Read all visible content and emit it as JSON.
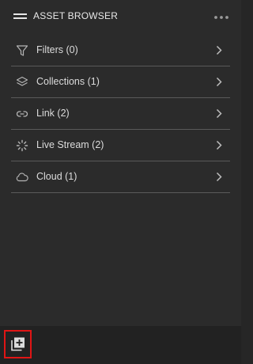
{
  "header": {
    "title": "ASSET BROWSER",
    "menu_icon": "hamburger-icon",
    "more_icon": "more-horizontal-icon"
  },
  "items": [
    {
      "label": "Filters (0)",
      "icon": "filter-icon"
    },
    {
      "label": "Collections (1)",
      "icon": "layers-icon"
    },
    {
      "label": "Link (2)",
      "icon": "link-icon"
    },
    {
      "label": "Live Stream (2)",
      "icon": "loading-spinner-icon"
    },
    {
      "label": "Cloud (1)",
      "icon": "cloud-icon"
    }
  ],
  "footer": {
    "add_icon": "add-collection-icon"
  },
  "colors": {
    "panel_bg": "#2b2b2b",
    "footer_bg": "#222222",
    "text": "#dcdcdc",
    "divider": "#5a5a5a",
    "highlight": "#e01515"
  }
}
